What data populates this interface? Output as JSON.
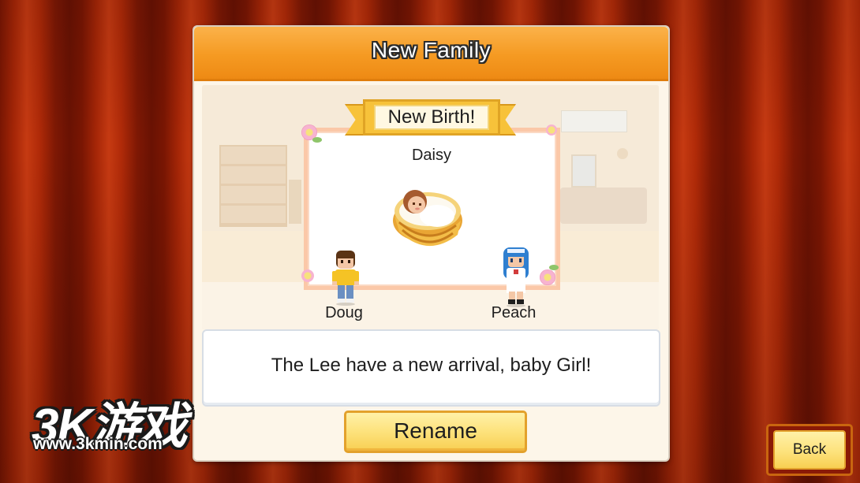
{
  "dialog": {
    "title": "New Family",
    "banner": "New Birth!",
    "baby_name": "Daisy",
    "father_name": "Doug",
    "mother_name": "Peach",
    "message": "The Lee have a new arrival, baby Girl!",
    "rename_label": "Rename"
  },
  "back_label": "Back",
  "watermark": {
    "brand": "3K游戏",
    "url": "www.3kmin.com"
  },
  "colors": {
    "header_orange": "#f59a22",
    "button_yellow": "#fde27c",
    "curtain_red": "#a62607"
  }
}
